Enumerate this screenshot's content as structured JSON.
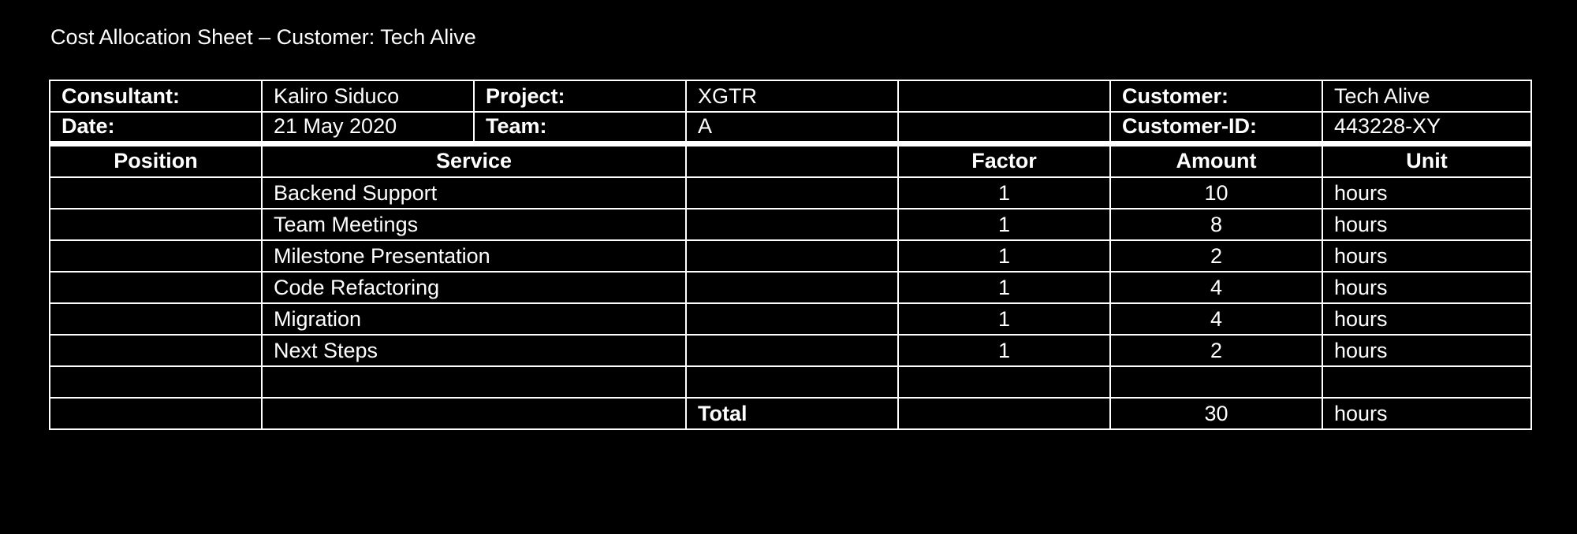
{
  "title": "Cost Allocation Sheet – Customer: Tech Alive",
  "info": {
    "consultant_label": "Consultant:",
    "consultant_value": "Kaliro Siduco",
    "project_label": "Project:",
    "project_value": "XGTR",
    "customer_label": "Customer:",
    "customer_value": "Tech Alive",
    "date_label": "Date:",
    "date_value": "21 May 2020",
    "team_label": "Team:",
    "team_value": "A",
    "customer_id_label": "Customer-ID:",
    "customer_id_value": "443228-XY"
  },
  "columns": {
    "position": "Position",
    "service": "Service",
    "factor": "Factor",
    "amount": "Amount",
    "unit": "Unit"
  },
  "rows": [
    {
      "position": "",
      "service": "Backend Support",
      "factor": "1",
      "amount": "10",
      "unit": "hours"
    },
    {
      "position": "",
      "service": "Team Meetings",
      "factor": "1",
      "amount": "8",
      "unit": "hours"
    },
    {
      "position": "",
      "service": "Milestone Presentation",
      "factor": "1",
      "amount": "2",
      "unit": "hours"
    },
    {
      "position": "",
      "service": "Code Refactoring",
      "factor": "1",
      "amount": "4",
      "unit": "hours"
    },
    {
      "position": "",
      "service": "Migration",
      "factor": "1",
      "amount": "4",
      "unit": "hours"
    },
    {
      "position": "",
      "service": "Next Steps",
      "factor": "1",
      "amount": "2",
      "unit": "hours"
    },
    {
      "position": "",
      "service": "",
      "factor": "",
      "amount": "",
      "unit": ""
    }
  ],
  "total": {
    "label": "Total",
    "amount": "30",
    "unit": "hours"
  }
}
